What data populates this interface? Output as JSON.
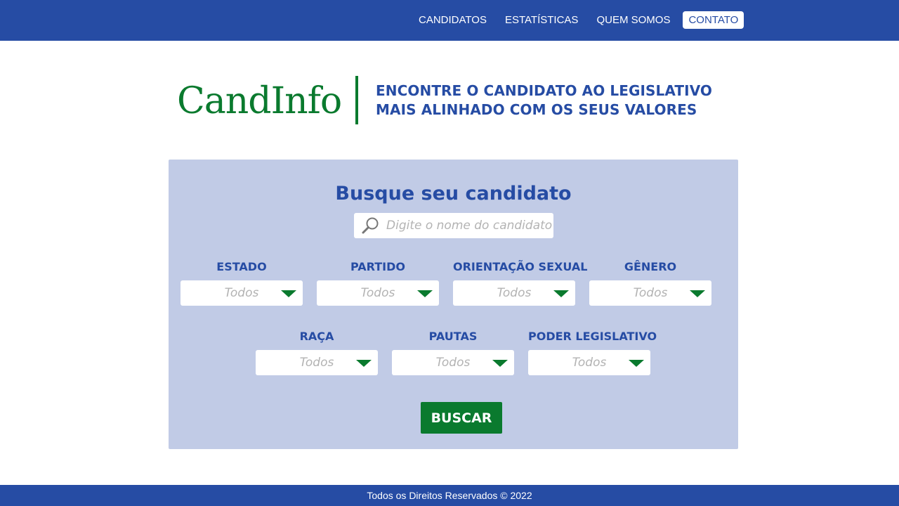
{
  "nav": {
    "items": [
      {
        "label": "CANDIDATOS"
      },
      {
        "label": "ESTATÍSTICAS"
      },
      {
        "label": "QUEM SOMOS"
      },
      {
        "label": "CONTATO",
        "active": true
      }
    ]
  },
  "brand": {
    "name": "CandInfo",
    "tagline_line1": "ENCONTRE O CANDIDATO AO LEGISLATIVO",
    "tagline_line2": "MAIS ALINHADO COM OS SEUS VALORES"
  },
  "search": {
    "title": "Busque seu candidato",
    "placeholder": "Digite o nome do candidato",
    "value": "",
    "icon": "search-icon"
  },
  "filters": [
    {
      "label": "ESTADO",
      "value": "Todos"
    },
    {
      "label": "PARTIDO",
      "value": "Todos"
    },
    {
      "label": "ORIENTAÇÃO SEXUAL",
      "value": "Todos"
    },
    {
      "label": "GÊNERO",
      "value": "Todos"
    },
    {
      "label": "RAÇA",
      "value": "Todos"
    },
    {
      "label": "PAUTAS",
      "value": "Todos"
    },
    {
      "label": "PODER LEGISLATIVO",
      "value": "Todos"
    }
  ],
  "button": {
    "label": "BUSCAR"
  },
  "footer": {
    "text": "Todos os Direitos Reservados © 2022"
  },
  "colors": {
    "primary": "#264ca4",
    "accent": "#0a7a2e",
    "panel": "#c1cbe6",
    "placeholder": "#b3b3b3"
  }
}
